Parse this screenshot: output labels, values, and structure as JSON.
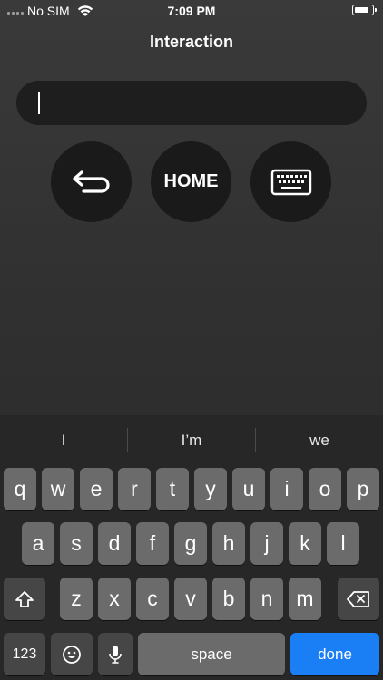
{
  "status_bar": {
    "carrier": "No SIM",
    "time": "7:09 PM"
  },
  "nav": {
    "title": "Interaction"
  },
  "input": {
    "value": "",
    "placeholder": ""
  },
  "controls": {
    "back_icon": "return-arrow-icon",
    "home_label": "HOME",
    "keyboard_icon": "keyboard-icon"
  },
  "keyboard": {
    "suggestions": [
      "I",
      "I’m",
      "we"
    ],
    "row1": [
      "q",
      "w",
      "e",
      "r",
      "t",
      "y",
      "u",
      "i",
      "o",
      "p"
    ],
    "row2": [
      "a",
      "s",
      "d",
      "f",
      "g",
      "h",
      "j",
      "k",
      "l"
    ],
    "row3": [
      "z",
      "x",
      "c",
      "v",
      "b",
      "n",
      "m"
    ],
    "numbers_label": "123",
    "space_label": "space",
    "done_label": "done",
    "shift_icon": "shift-icon",
    "delete_icon": "delete-icon",
    "emoji_icon": "emoji-icon",
    "mic_icon": "microphone-icon",
    "accent_color": "#1a7ef5"
  }
}
